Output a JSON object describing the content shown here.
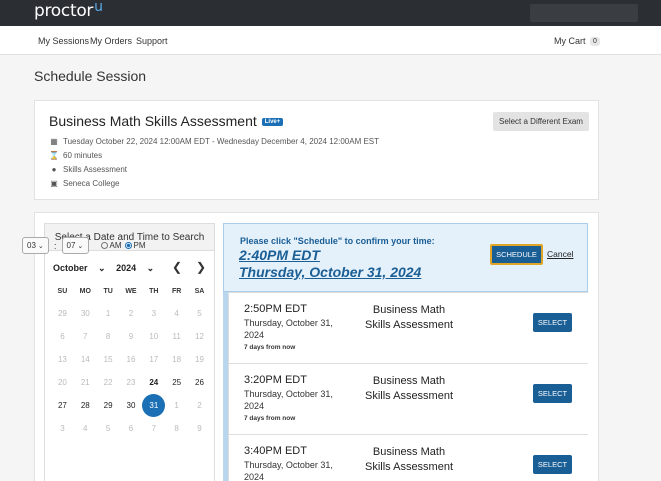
{
  "app": {
    "logo": "proctor",
    "logo_accent": "u"
  },
  "nav": {
    "my_sessions": "My Sessions",
    "my_orders": "My Orders",
    "support": "Support",
    "my_cart": "My Cart",
    "cart_count": "0"
  },
  "page": {
    "title": "Schedule Session"
  },
  "exam": {
    "title": "Business Math Skills Assessment",
    "live_badge": "Live+",
    "different_exam_button": "Select a Different Exam",
    "window": "Tuesday October 22, 2024 12:00AM EDT - Wednesday December 4, 2024 12:00AM EST",
    "duration": "60 minutes",
    "type": "Skills Assessment",
    "institution": "Seneca College"
  },
  "calendar": {
    "header": "Select a Date and Time to Search",
    "month": "October",
    "year": "2024",
    "weekdays": [
      "SU",
      "MO",
      "TU",
      "WE",
      "TH",
      "FR",
      "SA"
    ],
    "days": [
      [
        "29",
        "30",
        "1",
        "2",
        "3",
        "4",
        "5"
      ],
      [
        "6",
        "7",
        "8",
        "9",
        "10",
        "11",
        "12"
      ],
      [
        "13",
        "14",
        "15",
        "16",
        "17",
        "18",
        "19"
      ],
      [
        "20",
        "21",
        "22",
        "23",
        "24",
        "25",
        "26"
      ],
      [
        "27",
        "28",
        "29",
        "30",
        "31",
        "1",
        "2"
      ],
      [
        "3",
        "4",
        "5",
        "6",
        "7",
        "8",
        "9"
      ]
    ],
    "selected_day": "31",
    "hour": "03",
    "minute": "07",
    "am_label": "AM",
    "pm_label": "PM",
    "period": "PM"
  },
  "confirm": {
    "message": "Please click \"Schedule\" to confirm your time:",
    "time": "2:40PM EDT",
    "date": "Thursday, October 31, 2024",
    "schedule_button": "SCHEDULE",
    "cancel_link": "Cancel"
  },
  "slots": [
    {
      "time": "2:50PM EDT",
      "date": "Thursday, October 31, 2024",
      "relative": "7 days from now",
      "exam": "Business Math Skills Assessment",
      "button": "SELECT"
    },
    {
      "time": "3:20PM EDT",
      "date": "Thursday, October 31, 2024",
      "relative": "7 days from now",
      "exam": "Business Math Skills Assessment",
      "button": "SELECT"
    },
    {
      "time": "3:40PM EDT",
      "date": "Thursday, October 31, 2024",
      "relative": "",
      "exam": "Business Math Skills Assessment",
      "button": "SELECT"
    }
  ]
}
